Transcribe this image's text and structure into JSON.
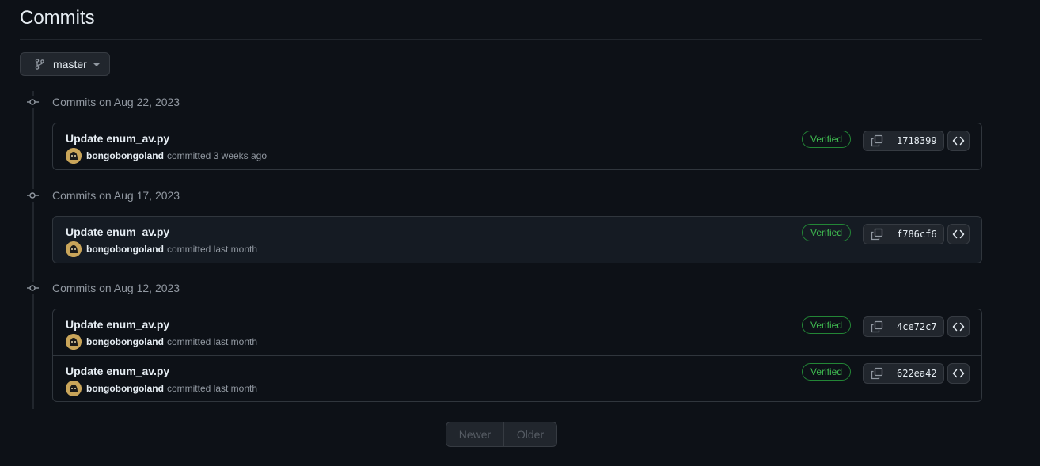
{
  "page": {
    "title": "Commits"
  },
  "branch": {
    "name": "master",
    "icon": "git-branch-icon"
  },
  "groups": [
    {
      "label": "Commits on Aug 22, 2023",
      "commits": [
        {
          "message": "Update enum_av.py",
          "author": "bongobongoland",
          "when": "committed 3 weeks ago",
          "verified": "Verified",
          "sha": "1718399"
        }
      ]
    },
    {
      "label": "Commits on Aug 17, 2023",
      "commits": [
        {
          "message": "Update enum_av.py",
          "author": "bongobongoland",
          "when": "committed last month",
          "verified": "Verified",
          "sha": "f786cf6"
        }
      ]
    },
    {
      "label": "Commits on Aug 12, 2023",
      "commits": [
        {
          "message": "Update enum_av.py",
          "author": "bongobongoland",
          "when": "committed last month",
          "verified": "Verified",
          "sha": "4ce72c7"
        },
        {
          "message": "Update enum_av.py",
          "author": "bongobongoland",
          "when": "committed last month",
          "verified": "Verified",
          "sha": "622ea42"
        }
      ]
    }
  ],
  "pagination": {
    "newer": "Newer",
    "older": "Older"
  },
  "colors": {
    "background": "#0d1117",
    "border": "#30363d",
    "verified": "#3fb950",
    "muted_text": "#9198a1",
    "avatar": "#c9a55a"
  }
}
